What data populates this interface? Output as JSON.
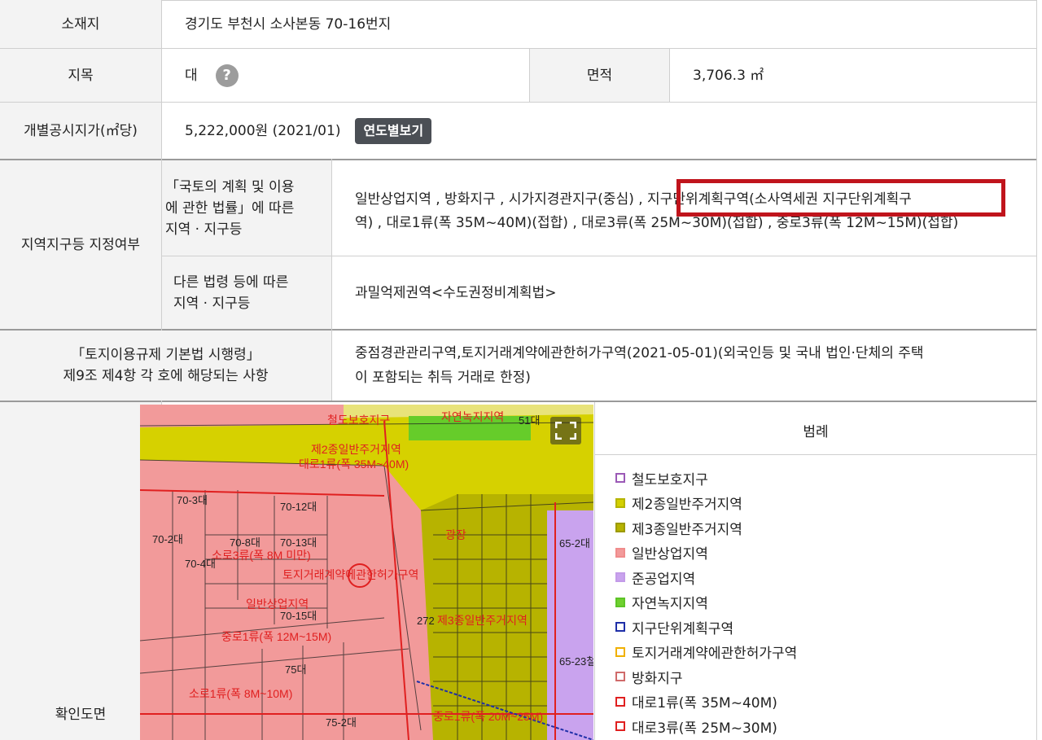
{
  "rows": {
    "location": {
      "label": "소재지",
      "value": "경기도 부천시 소사본동 70-16번지"
    },
    "land_category": {
      "label": "지목",
      "value": "대",
      "area_label": "면적",
      "area_value": "3,706.3 ㎡"
    },
    "price": {
      "label": "개별공시지가(㎡당)",
      "value": "5,222,000원 (2021/01)",
      "button": "연도별보기"
    },
    "zoning": {
      "label": "지역지구등 지정여부",
      "sub1_label": "「국토의 계획 및 이용\n 에 관한 법률」에 따른\n 지역 · 지구등",
      "sub1_value_line1": "일반상업지역 , 방화지구 , 시가지경관지구(중심) , 지구단위계획구역(소사역세권 지구단위계획구",
      "sub1_value_line2": "역) , 대로1류(폭 35M~40M)(접합) , 대로3류(폭 25M~30M)(접합) , 중로3류(폭 12M~15M)(접합)",
      "sub2_label": "다른 법령 등에 따른\n지역 · 지구등",
      "sub2_value": "과밀억제권역<수도권정비계획법>"
    },
    "regulation": {
      "label": "「토지이용규제 기본법 시행령」\n제9조 제4항 각 호에 해당되는 사항",
      "value_line1": "중점경관관리구역,토지거래계약에관한허가구역(2021-05-01)(외국인등 및 국내 법인·단체의 주택",
      "value_line2": "이 포함되는 취득 거래로 한정)"
    },
    "map": {
      "label": "확인도면"
    }
  },
  "legend": {
    "title": "범례",
    "items": [
      {
        "label": "철도보호지구",
        "color": "#9b59b6",
        "fill": "none"
      },
      {
        "label": "제2종일반주거지역",
        "color": "#b5b400",
        "fill": "#d4d000"
      },
      {
        "label": "제3종일반주거지역",
        "color": "#9c9a00",
        "fill": "#b7b300"
      },
      {
        "label": "일반상업지역",
        "color": "#f08c8c",
        "fill": "#f29a9a"
      },
      {
        "label": "준공업지역",
        "color": "#c39be8",
        "fill": "#c9a3ee"
      },
      {
        "label": "자연녹지지역",
        "color": "#5dc427",
        "fill": "#6fd030"
      },
      {
        "label": "지구단위계획구역",
        "color": "#1f2fa8",
        "fill": "none"
      },
      {
        "label": "토지거래계약에관한허가구역",
        "color": "#f0b000",
        "fill": "none"
      },
      {
        "label": "방화지구",
        "color": "#d06a6a",
        "fill": "none"
      },
      {
        "label": "대로1류(폭 35M~40M)",
        "color": "#e02020",
        "fill": "none"
      },
      {
        "label": "대로3류(폭 25M~30M)",
        "color": "#e02020",
        "fill": "none"
      }
    ]
  },
  "map_labels": {
    "a": "철도보호지구",
    "b": "자연녹지지역",
    "c": "제2종일반주거지역",
    "d": "대로1류(폭 35M~40M)",
    "e": "소로3류(폭 8M 미만)",
    "f": "토지거래계약에관한허가구역",
    "g": "일반상업지역",
    "h": "중로1류(폭 12M~15M)",
    "i": "중로1류(폭 20M~25M)",
    "j": "광장",
    "k": "제3종일반주거지역",
    "l": "소로1류(폭 8M~10M)",
    "p1": "70-3대",
    "p2": "70-12대",
    "p3": "70-13대",
    "p4": "70-8대",
    "p5": "70-4대",
    "p6": "70-2대",
    "p7": "70-15대",
    "p8": "75대",
    "p9": "75-2대",
    "p10": "65-2대",
    "p11": "65-23철",
    "p12": "272",
    "p13": "51대"
  }
}
